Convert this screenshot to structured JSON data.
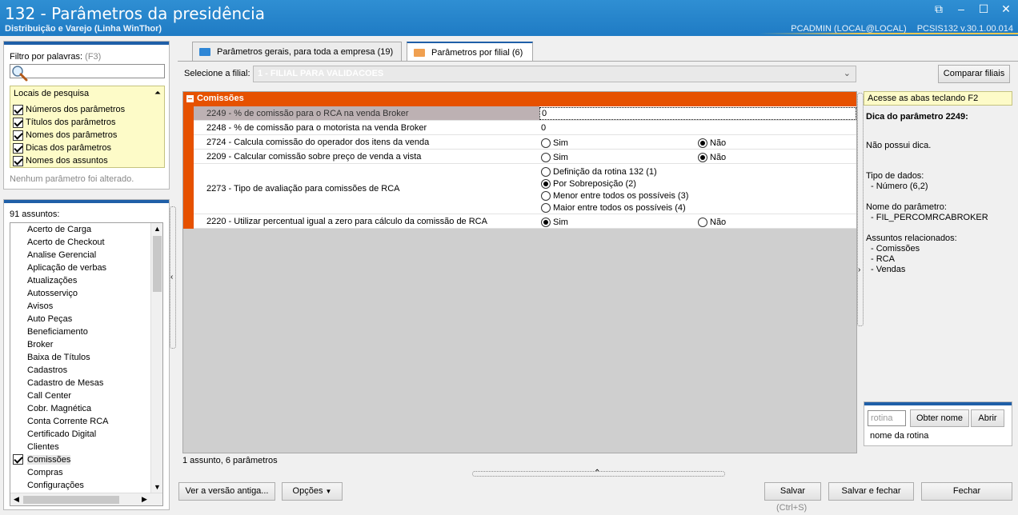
{
  "window": {
    "title": "132 - Parâmetros da presidência",
    "subtitle": "Distribuição e Varejo (Linha WinThor)",
    "user": "PCADMIN (LOCAL@LOCAL)",
    "version": "PCSIS132  v.30.1.00.014"
  },
  "filter": {
    "label": "Filtro por palavras:",
    "shortcut": "(F3)",
    "value": "",
    "locais_title": "Locais de pesquisa",
    "locais": [
      {
        "label": "Números dos parâmetros",
        "checked": true
      },
      {
        "label": "Títulos dos parâmetros",
        "checked": true
      },
      {
        "label": "Nomes dos parâmetros",
        "checked": true
      },
      {
        "label": "Dicas dos parâmetros",
        "checked": true
      },
      {
        "label": "Nomes dos assuntos",
        "checked": true
      }
    ],
    "status": "Nenhum parâmetro foi alterado."
  },
  "assuntos": {
    "count_label": "91 assuntos:",
    "items": [
      "Acerto de Carga",
      "Acerto de Checkout",
      "Analise Gerencial",
      "Aplicação de verbas",
      "Atualizações",
      "Autosserviço",
      "Avisos",
      "Auto Peças",
      "Beneficiamento",
      "Broker",
      "Baixa de Títulos",
      "Cadastros",
      "Cadastro de Mesas",
      "Call Center",
      "Cobr. Magnética",
      "Conta Corrente RCA",
      "Certificado Digital",
      "Clientes",
      "Comissões",
      "Compras",
      "Configurações"
    ],
    "checked_item": "Comissões"
  },
  "tabs": [
    {
      "label": "Parâmetros gerais, para toda a empresa",
      "count": "(19)"
    },
    {
      "label": "Parâmetros por filial",
      "count": "(6)"
    }
  ],
  "filial": {
    "label": "Selecione a filial:",
    "value": "1 - FILIAL PARA VALIDACOES",
    "compare_button": "Comparar filiais"
  },
  "group": {
    "title": "Comissões",
    "rows": [
      {
        "name": "2249 - % de comissão para o  RCA na venda Broker",
        "value": "0"
      },
      {
        "name": "2248 - % de comissão para o motorista na venda Broker",
        "value": "0"
      },
      {
        "name": "2724 - Calcula comissão do operador dos itens da venda",
        "opt1": "Sim",
        "opt2": "Não"
      },
      {
        "name": "2209 - Calcular comissão sobre preço de venda a vista",
        "opt1": "Sim",
        "opt2": "Não"
      },
      {
        "name": "2273 - Tipo de avaliação para comissões de RCA",
        "options": [
          "Definição da rotina 132 (1)",
          "Por Sobreposição (2)",
          "Menor entre todos os possíveis (3)",
          "Maior entre todos os possíveis (4)"
        ]
      },
      {
        "name": "2220 - Utilizar percentual igual a zero para cálculo da comissão de RCA",
        "opt1": "Sim",
        "opt2": "Não"
      }
    ]
  },
  "footer_count": "1 assunto, 6 parâmetros",
  "help": {
    "tip": "Acesse as abas teclando F2",
    "title": "Dica do parâmetro 2249:",
    "dica": "Não possui dica.",
    "tipo_label": "Tipo de dados:",
    "tipo_value": "- Número (6,2)",
    "nome_label": "Nome do parâmetro:",
    "nome_value": "- FIL_PERCOMRCABROKER",
    "rel_label": "Assuntos relacionados:",
    "rel": [
      "- Comissões",
      "- RCA",
      "- Vendas"
    ]
  },
  "rotina": {
    "placeholder": "rotina",
    "obter_button": "Obter nome",
    "abrir_button": "Abrir",
    "name_label": "nome da rotina"
  },
  "buttons": {
    "old_version": "Ver a versão antiga...",
    "options": "Opções",
    "save": "Salvar",
    "save_shortcut": "(Ctrl+S)",
    "save_close": "Salvar e fechar",
    "close": "Fechar"
  },
  "colors": {
    "titlebar": "#1f7bc4",
    "group": "#e65100",
    "tip": "#fdfbc8"
  }
}
